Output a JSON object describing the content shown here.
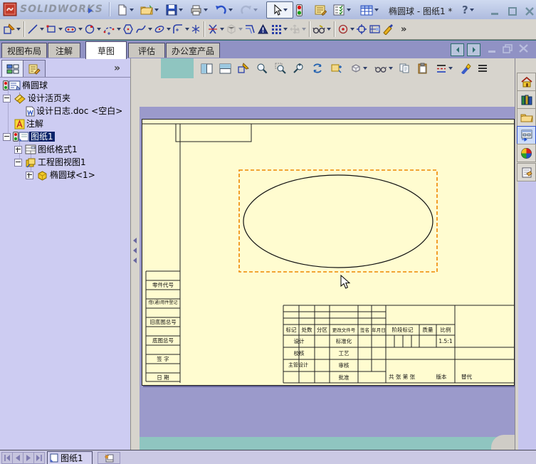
{
  "colors": {
    "sheet_bg": "#FFFCD0",
    "graphics_bg": "#9B9ACB",
    "panel_bg": "#CDCCF2",
    "tab_strip": "#9092C4",
    "view_border_orange": "#EE8700",
    "selection_blue": "#0A246A",
    "teal_band": "#8FC5C0"
  },
  "titlebar": {
    "brand": "SOLIDWORKS",
    "title": "椭圆球 - 图纸1 *",
    "help": "?"
  },
  "command_tabs": {
    "active": "草图",
    "items": [
      {
        "label": "视图布局"
      },
      {
        "label": "注解"
      },
      {
        "label": "草图"
      },
      {
        "label": "评估"
      },
      {
        "label": "办公室产品"
      }
    ]
  },
  "feature_tree": {
    "root": "椭圆球",
    "selected": "图纸1",
    "items": [
      {
        "label": "设计活页夹"
      },
      {
        "label": "设计日志.doc <空白>"
      },
      {
        "label": "注解"
      },
      {
        "label": "图纸1"
      },
      {
        "label": "图纸格式1"
      },
      {
        "label": "工程图视图1"
      },
      {
        "label": "椭圆球<1>"
      }
    ]
  },
  "sheet": {
    "left_labels": [
      "零件代号",
      "借(通)用件登记",
      "旧底图总号",
      "底图总号",
      "签 字",
      "日 期"
    ],
    "title_block": {
      "mark": "标记",
      "qty": "处数",
      "zone": "分区",
      "change_file": "更改文件号",
      "signature": "签名",
      "ymd": "年月日",
      "stage_mark": "阶段标记",
      "weight": "质量",
      "scale_label": "比例",
      "scale_value": "1.5:1",
      "design": "设计",
      "standardize": "标准化",
      "check": "校核",
      "process": "工艺",
      "chief_design": "主管设计",
      "audit": "审核",
      "approve": "批准",
      "sheets": "共 张 第 张",
      "version": "版本",
      "substitute": "替代"
    }
  },
  "bottom_bar": {
    "sheet_tab": "图纸1"
  },
  "chevron": "»"
}
